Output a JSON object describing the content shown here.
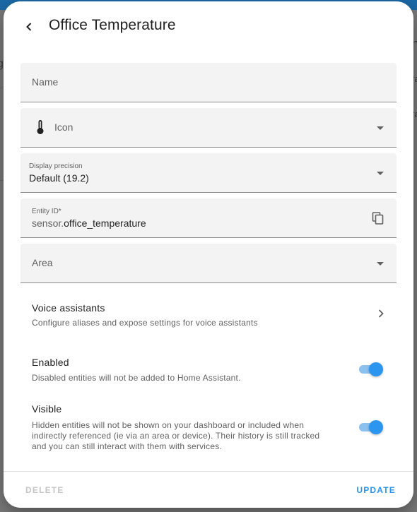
{
  "background": {
    "left_fragments": [
      "g"
    ],
    "right_fragments": [
      "n",
      "ra",
      "ra"
    ]
  },
  "dialog": {
    "title": "Office Temperature",
    "back_icon": "chevron-left-icon"
  },
  "fields": {
    "name": {
      "placeholder": "Name",
      "value": ""
    },
    "icon": {
      "placeholder": "Icon",
      "icon": "thermometer-icon"
    },
    "display_precision": {
      "label": "Display precision",
      "value": "Default (19.2)"
    },
    "entity_id": {
      "label": "Entity ID*",
      "prefix": "sensor.",
      "value": "office_temperature",
      "icon": "copy-icon"
    },
    "area": {
      "placeholder": "Area"
    }
  },
  "voice_assistants": {
    "title": "Voice assistants",
    "description": "Configure aliases and expose settings for voice assistants"
  },
  "enabled": {
    "title": "Enabled",
    "description": "Disabled entities will not be added to Home Assistant.",
    "on": true
  },
  "visible": {
    "title": "Visible",
    "description_lines": [
      "Hidden entities will not be shown on your dashboard or included when",
      "indirectly referenced (ie via an area or device). Their history is still tracked",
      "and you can still interact with them with services."
    ],
    "on": true
  },
  "footer": {
    "delete_label": "DELETE",
    "update_label": "UPDATE"
  },
  "colors": {
    "accent": "#2b95f0",
    "accent_track": "#8cc0ef",
    "disabled_text": "#c6c6c6"
  }
}
